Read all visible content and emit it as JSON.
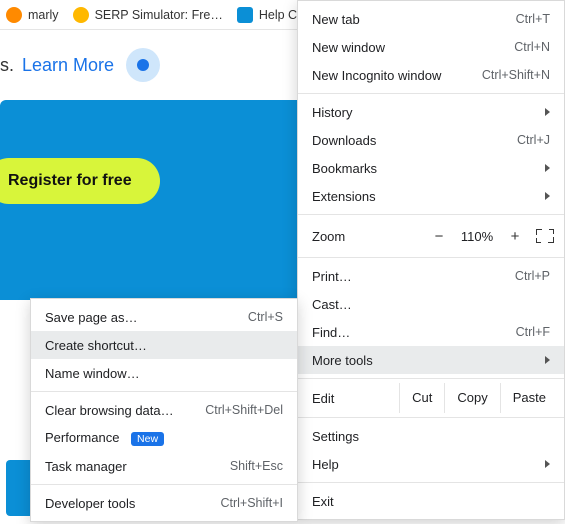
{
  "bookmark_bar": {
    "items": [
      {
        "label": "marly",
        "favicon_color": "#ff8a00"
      },
      {
        "label": "SERP Simulator: Fre…",
        "favicon_color": "#ffb800"
      },
      {
        "label": "Help Ce",
        "favicon_color": "#0b8fd6"
      }
    ]
  },
  "page": {
    "truncated_prefix": "s.",
    "learn_more": "Learn More",
    "register_button": "Register for free"
  },
  "menu": {
    "new_tab": {
      "label": "New tab",
      "accel": "Ctrl+T"
    },
    "new_window": {
      "label": "New window",
      "accel": "Ctrl+N"
    },
    "new_incognito": {
      "label": "New Incognito window",
      "accel": "Ctrl+Shift+N"
    },
    "history": {
      "label": "History"
    },
    "downloads": {
      "label": "Downloads",
      "accel": "Ctrl+J"
    },
    "bookmarks": {
      "label": "Bookmarks"
    },
    "extensions": {
      "label": "Extensions"
    },
    "zoom": {
      "label": "Zoom",
      "minus": "−",
      "value": "110%",
      "plus": "+"
    },
    "print": {
      "label": "Print…",
      "accel": "Ctrl+P"
    },
    "cast": {
      "label": "Cast…"
    },
    "find": {
      "label": "Find…",
      "accel": "Ctrl+F"
    },
    "more_tools": {
      "label": "More tools"
    },
    "edit": {
      "label": "Edit",
      "cut": "Cut",
      "copy": "Copy",
      "paste": "Paste"
    },
    "settings": {
      "label": "Settings"
    },
    "help": {
      "label": "Help"
    },
    "exit": {
      "label": "Exit"
    }
  },
  "submenu": {
    "save_page": {
      "label": "Save page as…",
      "accel": "Ctrl+S"
    },
    "create_shortcut": {
      "label": "Create shortcut…"
    },
    "name_window": {
      "label": "Name window…"
    },
    "clear_data": {
      "label": "Clear browsing data…",
      "accel": "Ctrl+Shift+Del"
    },
    "performance": {
      "label": "Performance",
      "badge": "New"
    },
    "task_manager": {
      "label": "Task manager",
      "accel": "Shift+Esc"
    },
    "dev_tools": {
      "label": "Developer tools",
      "accel": "Ctrl+Shift+I"
    }
  }
}
